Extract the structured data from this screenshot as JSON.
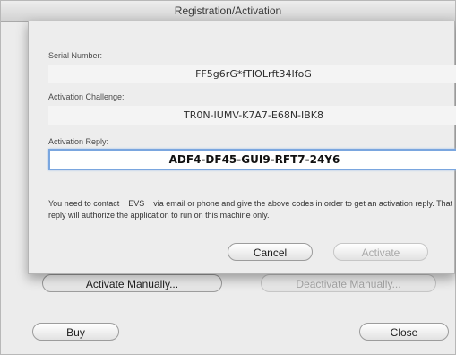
{
  "window": {
    "title": "Registration/Activation",
    "buttons": {
      "activate_manually": "Activate Manually...",
      "deactivate_manually": "Deactivate Manually...",
      "buy": "Buy",
      "close": "Close"
    }
  },
  "sheet": {
    "serial_label": "Serial Number:",
    "serial_value": "FF5g6rG*fTIOLrft34IfoG",
    "challenge_label": "Activation Challenge:",
    "challenge_value": "TR0N-IUMV-K7A7-E68N-IBK8",
    "reply_label": "Activation Reply:",
    "reply_value": "ADF4-DF45-GUI9-RFT7-24Y6",
    "instructions_part1": "You need to contact",
    "contact_name": "EVS",
    "instructions_part2": "via email or phone and give the above codes in order to get an activation reply. That reply will authorize the application to run on this machine only.",
    "cancel_label": "Cancel",
    "activate_label": "Activate"
  }
}
